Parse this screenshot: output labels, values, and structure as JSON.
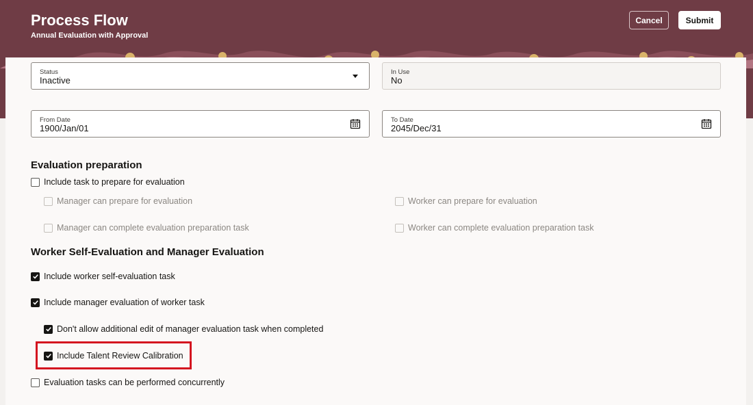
{
  "header": {
    "title": "Process Flow",
    "subtitle": "Annual Evaluation with Approval",
    "cancel_label": "Cancel",
    "submit_label": "Submit",
    "accent_color": "#6f3c45"
  },
  "fields": {
    "status": {
      "label": "Status",
      "value": "Inactive"
    },
    "in_use": {
      "label": "In Use",
      "value": "No"
    },
    "from_date": {
      "label": "From Date",
      "value": "1900/Jan/01"
    },
    "to_date": {
      "label": "To Date",
      "value": "2045/Dec/31"
    }
  },
  "evaluation_preparation": {
    "title": "Evaluation preparation",
    "include_prepare": {
      "label": "Include task to prepare for evaluation",
      "checked": false
    },
    "manager_prepare": {
      "label": "Manager can prepare for evaluation",
      "checked": false,
      "disabled": true
    },
    "worker_prepare": {
      "label": "Worker can prepare for evaluation",
      "checked": false,
      "disabled": true
    },
    "manager_complete_prep": {
      "label": "Manager can complete evaluation preparation task",
      "checked": false,
      "disabled": true
    },
    "worker_complete_prep": {
      "label": "Worker can complete evaluation preparation task",
      "checked": false,
      "disabled": true
    }
  },
  "self_and_manager_evaluation": {
    "title": "Worker Self-Evaluation and Manager Evaluation",
    "include_self_eval": {
      "label": "Include worker self-evaluation task",
      "checked": true
    },
    "include_manager_eval": {
      "label": "Include manager evaluation of worker task",
      "checked": true
    },
    "no_additional_edit": {
      "label": "Don't allow additional edit of manager evaluation task when completed",
      "checked": true
    },
    "talent_review": {
      "label": "Include Talent Review Calibration",
      "checked": true
    },
    "concurrent": {
      "label": "Evaluation tasks can be performed concurrently",
      "checked": false
    }
  },
  "highlight_color": "#d4121f"
}
